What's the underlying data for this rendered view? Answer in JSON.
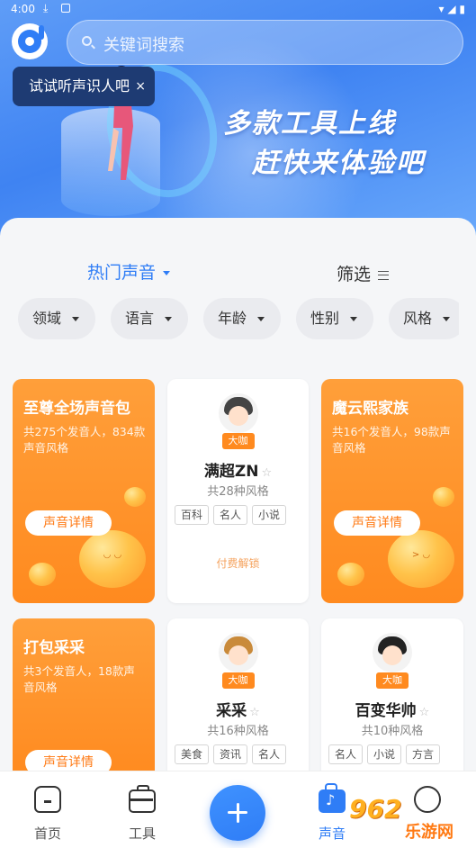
{
  "statusbar": {
    "time": "4:00"
  },
  "search": {
    "placeholder": "关键词搜索"
  },
  "tooltip": {
    "text": "试试听声识人吧",
    "close": "×"
  },
  "banner": {
    "line1": "多款工具上线",
    "line2": "赶快来体验吧"
  },
  "tabs": {
    "hot": "热门声音",
    "filter": "筛选"
  },
  "chips": [
    "领域",
    "语言",
    "年龄",
    "性别",
    "风格"
  ],
  "packs": [
    {
      "title": "至尊全场声音包",
      "desc": "共275个发音人，834款声音风格",
      "button": "声音详情"
    },
    {
      "title": "魔云熙家族",
      "desc": "共16个发音人，98款声音风格",
      "button": "声音详情"
    },
    {
      "title": "打包采采",
      "desc": "共3个发音人，18款声音风格",
      "button": "声音详情"
    }
  ],
  "voices": [
    {
      "name": "满超ZN",
      "badge": "大咖",
      "count": "共28种风格",
      "tags": [
        "百科",
        "名人",
        "小说"
      ],
      "unlock": "付费解锁"
    },
    {
      "name": "采采",
      "badge": "大咖",
      "count": "共16种风格",
      "tags": [
        "美食",
        "资讯",
        "名人"
      ]
    },
    {
      "name": "百变华帅",
      "badge": "大咖",
      "count": "共10种风格",
      "tags": [
        "名人",
        "小说",
        "方言"
      ]
    }
  ],
  "nav": {
    "home": "首页",
    "tools": "工具",
    "sound": "声音"
  },
  "watermark": {
    "logo": "962",
    "text": "乐游网"
  },
  "colors": {
    "accent": "#2f7df6",
    "orange": "#ff8a1f"
  }
}
